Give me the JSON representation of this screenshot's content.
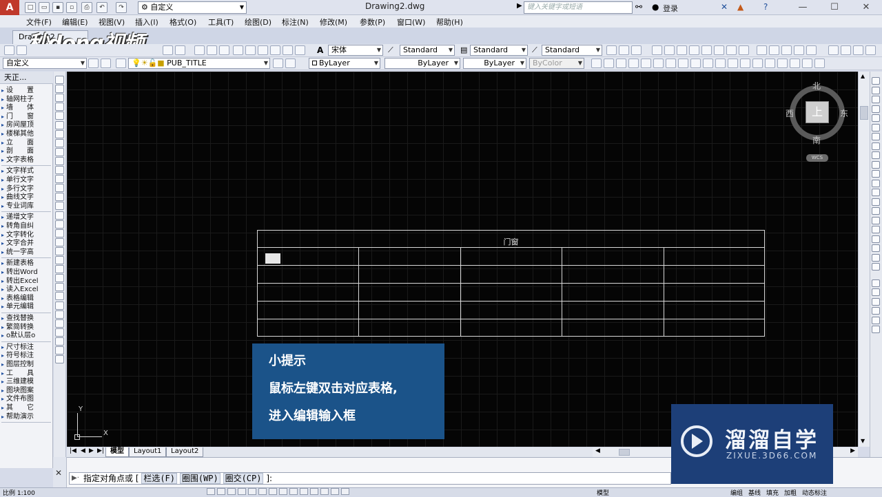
{
  "title_bar": {
    "app_letter": "A",
    "workspace": "自定义",
    "document_title": "Drawing2.dwg",
    "search_placeholder": "键入关键字或短语",
    "login": "登录"
  },
  "menu": [
    "文件(F)",
    "编辑(E)",
    "视图(V)",
    "插入(I)",
    "格式(O)",
    "工具(T)",
    "绘图(D)",
    "标注(N)",
    "修改(M)",
    "参数(P)",
    "窗口(W)",
    "帮助(H)"
  ],
  "file_tab": "Drawing2",
  "watermark_logo": "秒dong视频",
  "toolbar": {
    "font": "宋体",
    "text_style": "Standard",
    "dim_style": "Standard",
    "table_style": "Standard",
    "view_name": "自定义",
    "layer": "PUB_TITLE",
    "color": "ByLayer",
    "linetype": "ByLayer",
    "lineweight": "ByLayer",
    "plot_style": "ByColor"
  },
  "left_panel": {
    "title": "天正...",
    "groups": [
      [
        "设　　置",
        "轴网柱子",
        "墙　　体",
        "门　　窗",
        "房间屋顶",
        "楼梯其他",
        "立　　面",
        "剖　　面",
        "文字表格"
      ],
      [
        "文字样式",
        "单行文字",
        "多行文字",
        "曲线文字",
        "专业词库"
      ],
      [
        "递增文字",
        "转角自纠",
        "文字转化",
        "文字合并",
        "统一字高"
      ],
      [
        "新建表格",
        "转出Word",
        "转出Excel",
        "读入Excel",
        "表格编辑",
        "单元编辑"
      ],
      [
        "查找替换",
        "繁简转换",
        "o默认层o"
      ],
      [
        "尺寸标注",
        "符号标注",
        "图层控制",
        "工　　具",
        "三维建模",
        "图块图案",
        "文件布图",
        "其　　它",
        "帮助演示"
      ]
    ]
  },
  "viewcube": {
    "north": "北",
    "south": "南",
    "east": "东",
    "west": "西",
    "top": "上",
    "wcs": "WCS"
  },
  "drawing": {
    "table_title": "门窗",
    "rows": 5,
    "cols": 5
  },
  "tip": {
    "heading": "小提示",
    "line1": "鼠标左键双击对应表格,",
    "line2": "进入编辑输入框"
  },
  "ucs": {
    "x": "X",
    "y": "Y"
  },
  "layout_tabs": [
    "模型",
    "Layout1",
    "Layout2"
  ],
  "command_line": {
    "prompt": "指定对角点或 [",
    "opt1": "栏选(F)",
    "opt2": "圈围(WP)",
    "opt3": "圈交(CP)",
    "suffix": "]:"
  },
  "status_bar": {
    "scale": "比例 1:100",
    "model": "模型",
    "right_labels": [
      "编组",
      "基线",
      "填充",
      "加粗",
      "动态标注"
    ]
  },
  "brand": {
    "name": "溜溜自学",
    "url": "ZIXUE.3D66.COM"
  }
}
